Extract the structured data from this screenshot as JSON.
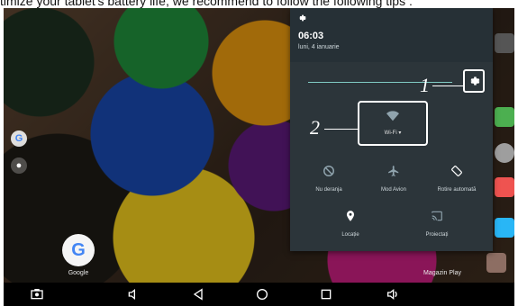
{
  "instruction_line": "timize your tablet's battery life, we recommend to follow the following tips :",
  "status_panel": {
    "time": "06:03",
    "date": "luni, 4 ianuarie"
  },
  "callouts": {
    "one": "1",
    "two": "2"
  },
  "wifi_tile": {
    "label": "Wi-Fi ▾"
  },
  "tiles": [
    {
      "label": "Nu deranja",
      "icon": "do-not-disturb-icon"
    },
    {
      "label": "Mod Avion",
      "icon": "airplane-icon"
    },
    {
      "label": "Rotire automată",
      "icon": "auto-rotate-icon"
    },
    {
      "label": "Locație",
      "icon": "location-icon"
    },
    {
      "label": "Proiectați",
      "icon": "cast-icon"
    }
  ],
  "desktop_apps": {
    "google": "Google",
    "play": "Magazin Play"
  },
  "colors": {
    "panel": "#2c353a",
    "panel_header": "#263036",
    "slider": "#80cbc4"
  }
}
